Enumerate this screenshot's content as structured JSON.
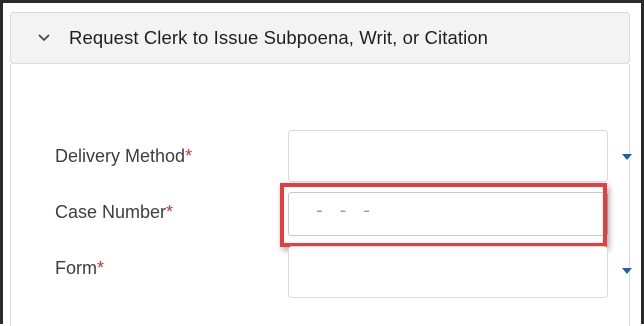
{
  "section": {
    "title": "Request Clerk to Issue Subpoena, Writ, or Citation",
    "chevron_icon": "chevron-down-icon"
  },
  "fields": {
    "delivery_method": {
      "label": "Delivery Method",
      "required_marker": "*",
      "value": ""
    },
    "case_number": {
      "label": "Case Number",
      "required_marker": "*",
      "placeholder": "- -   -"
    },
    "form": {
      "label": "Form",
      "required_marker": "*",
      "value": ""
    }
  },
  "colors": {
    "required": "#c23934",
    "highlight": "#e53e3e",
    "dropdown_arrow": "#1b5fae"
  }
}
